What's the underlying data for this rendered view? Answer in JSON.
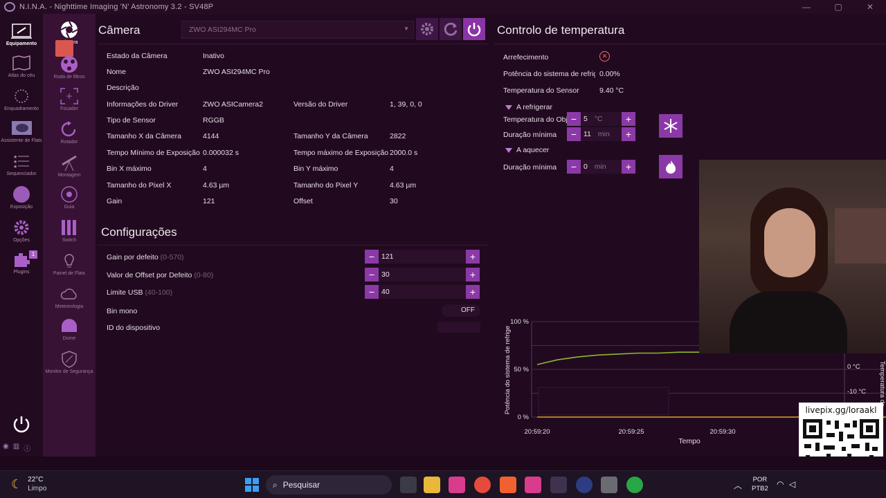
{
  "window": {
    "title": "N.I.N.A. - Nighttime Imaging 'N' Astronomy 3.2 - SV48P"
  },
  "rail": {
    "items": [
      {
        "label": "Equipamento",
        "icon": "equipment-icon"
      },
      {
        "label": "Atlas do céu",
        "icon": "sky-atlas-icon"
      },
      {
        "label": "Enquadramento",
        "icon": "framing-icon"
      },
      {
        "label": "Assistente de Flats",
        "icon": "flats-wizard-icon"
      },
      {
        "label": "Sequenciador",
        "icon": "sequencer-icon"
      },
      {
        "label": "Exposição",
        "icon": "imaging-icon"
      },
      {
        "label": "Opções",
        "icon": "options-icon"
      },
      {
        "label": "Plugins",
        "icon": "plugins-icon",
        "badge": "1"
      }
    ],
    "collapse": "<<"
  },
  "subnav": {
    "items": [
      {
        "label": "Câmera",
        "icon": "camera-icon"
      },
      {
        "label": "Roda de filtros",
        "icon": "filter-wheel-icon"
      },
      {
        "label": "Focador",
        "icon": "focuser-icon"
      },
      {
        "label": "Rotador",
        "icon": "rotator-icon"
      },
      {
        "label": "Montagem",
        "icon": "mount-icon"
      },
      {
        "label": "Guia",
        "icon": "guider-icon"
      },
      {
        "label": "Switch",
        "icon": "switch-icon"
      },
      {
        "label": "Painel de Flats",
        "icon": "flat-panel-icon"
      },
      {
        "label": "Meteorologia",
        "icon": "weather-icon"
      },
      {
        "label": "Dome",
        "icon": "dome-icon"
      },
      {
        "label": "Monitor de Segurança",
        "icon": "safety-monitor-icon"
      }
    ]
  },
  "camera": {
    "title": "Câmera",
    "device_selected": "ZWO ASI294MC Pro",
    "info": [
      {
        "label": "Estado da Câmera",
        "value": "Inativo"
      },
      {
        "label": "Nome",
        "value": "ZWO ASI294MC Pro"
      },
      {
        "label": "Descrição",
        "value": ""
      },
      {
        "label": "Informações do Driver",
        "value": "ZWO ASICamera2",
        "label2": "Versão do Driver",
        "value2": "1, 39, 0, 0"
      },
      {
        "label": "Tipo de Sensor",
        "value": "RGGB"
      },
      {
        "label": "Tamanho X da Câmera",
        "value": "4144",
        "label2": "Tamanho Y da Câmera",
        "value2": "2822"
      },
      {
        "label": "Tempo Mínimo de Exposição",
        "value": "0.000032 s",
        "label2": "Tempo máximo de Exposição",
        "value2": "2000.0 s"
      },
      {
        "label": "Bin X máximo",
        "value": "4",
        "label2": "Bin Y máximo",
        "value2": "4"
      },
      {
        "label": "Tamanho do Pixel X",
        "value": "4.63 µm",
        "label2": "Tamanho do Pixel Y",
        "value2": "4.63 µm"
      },
      {
        "label": "Gain",
        "value": "121",
        "label2": "Offset",
        "value2": "30"
      }
    ]
  },
  "settings": {
    "title": "Configurações",
    "gain_label": "Gain por defeito",
    "gain_range": "(0-570)",
    "gain_value": "121",
    "offset_label": "Valor de Offset por Defeito",
    "offset_range": "(0-80)",
    "offset_value": "30",
    "usb_label": "Limite USB",
    "usb_range": "(40-100)",
    "usb_value": "40",
    "binmono_label": "Bin mono",
    "binmono_state": "OFF",
    "deviceid_label": "ID do dispositivo"
  },
  "temperature": {
    "title": "Controlo de temperatura",
    "cooling_label": "Arrefecimento",
    "power_label": "Potência do sistema de refrigeração",
    "power_value": "0.00%",
    "sensor_label": "Temperatura do Sensor",
    "sensor_value": "9.40 °C",
    "cooling_section": "A refrigerar",
    "target_label": "Temperatura do Objetivo",
    "target_value": "5",
    "target_unit": "°C",
    "min_duration_label": "Duração mínima",
    "cool_duration_value": "11",
    "duration_unit": "min",
    "warming_section": "A aquecer",
    "warm_duration_value": "0"
  },
  "chart_data": {
    "type": "line",
    "xlabel": "Tempo",
    "ylabel": "Potência do sistema de refrige",
    "y2label": "Temperatura do",
    "x_ticks": [
      "20:59:20",
      "20:59:25",
      "20:59:30"
    ],
    "y_ticks": [
      "100 %",
      "50 %",
      "0 %"
    ],
    "y2_ticks": [
      "0 °C",
      "-10 °C"
    ],
    "ylim": [
      0,
      100
    ],
    "legend_position": "bottom-left",
    "series": [
      {
        "name": "Temperatura do Sensor",
        "color": "#8fb82e",
        "values": [
          55,
          60,
          63,
          65,
          66,
          67,
          67,
          68,
          68
        ]
      },
      {
        "name": "Potência do sistema de refrigeração",
        "color": "#e1a224",
        "values": [
          0,
          0,
          0,
          0,
          0,
          0,
          0,
          0,
          0
        ]
      }
    ]
  },
  "overlay": {
    "qr_text": "livepix.gg/loraakl"
  },
  "taskbar": {
    "weather_temp": "22°C",
    "weather_desc": "Limpo",
    "search_placeholder": "Pesquisar",
    "lang": "POR",
    "lang2": "PTB2"
  },
  "colors": {
    "accent": "#8c39a8",
    "background": "#210a1f"
  }
}
